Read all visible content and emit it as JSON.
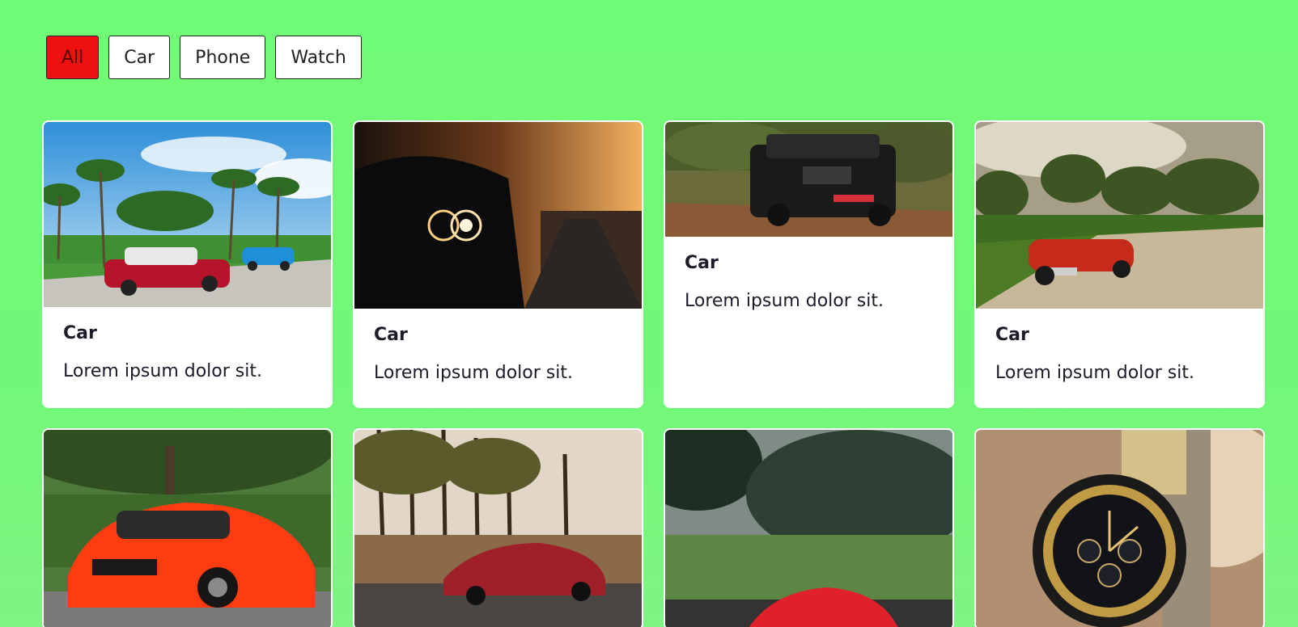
{
  "filters": [
    {
      "label": "All",
      "active": true
    },
    {
      "label": "Car",
      "active": false
    },
    {
      "label": "Phone",
      "active": false
    },
    {
      "label": "Watch",
      "active": false
    }
  ],
  "cards": [
    {
      "title": "Car",
      "text": "Lorem ipsum dolor sit.",
      "image": "classic-cars-palm-trees"
    },
    {
      "title": "Car",
      "text": "Lorem ipsum dolor sit.",
      "image": "black-muscle-car-sunset"
    },
    {
      "title": "Car",
      "text": "Lorem ipsum dolor sit.",
      "image": "black-suv-offroad"
    },
    {
      "title": "Car",
      "text": "Lorem ipsum dolor sit.",
      "image": "red-convertible-dirt-road"
    },
    {
      "image": "red-mercedes-amg-gt"
    },
    {
      "image": "red-sportscar-forest-road"
    },
    {
      "image": "red-car-motion-blur"
    },
    {
      "image": "horizen-chronograph-watch"
    }
  ],
  "colors": {
    "background": "#70f976",
    "active_filter": "#ee1111",
    "card": "#ffffff"
  }
}
